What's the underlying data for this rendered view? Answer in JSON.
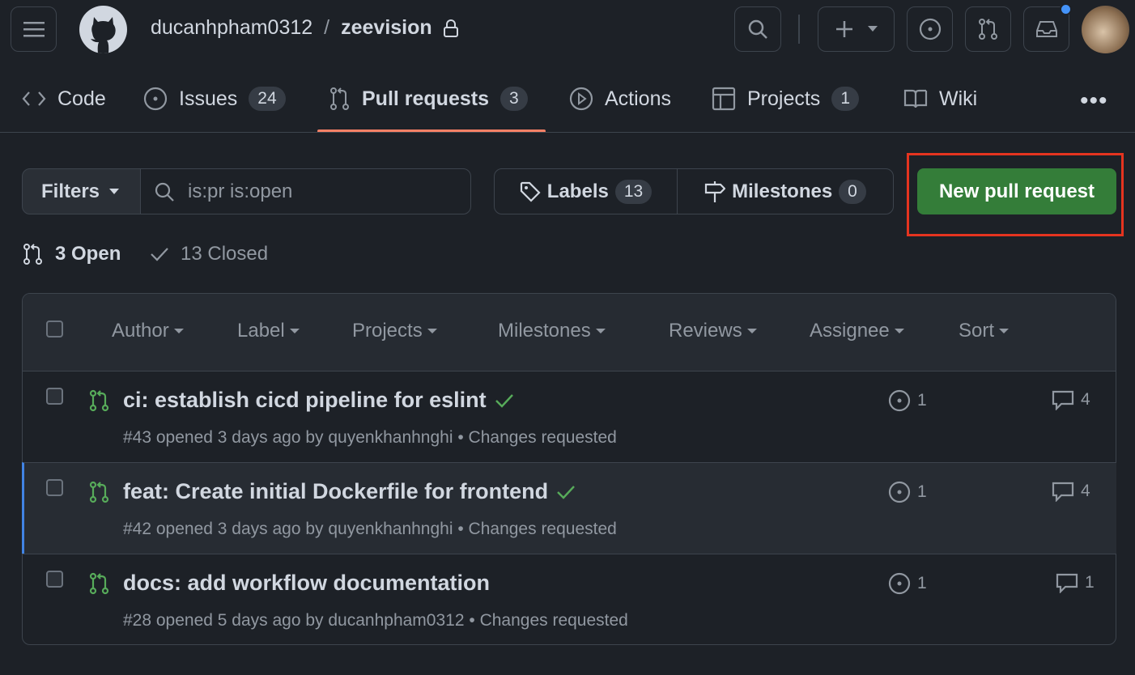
{
  "header": {
    "owner": "ducanhpham0312",
    "separator": "/",
    "repo": "zeevision"
  },
  "tabs": [
    {
      "label": "Code"
    },
    {
      "label": "Issues",
      "count": "24"
    },
    {
      "label": "Pull requests",
      "count": "3"
    },
    {
      "label": "Actions"
    },
    {
      "label": "Projects",
      "count": "1"
    },
    {
      "label": "Wiki"
    }
  ],
  "toolbar": {
    "filters_label": "Filters",
    "search_value": "is:pr is:open",
    "labels_label": "Labels",
    "labels_count": "13",
    "milestones_label": "Milestones",
    "milestones_count": "0",
    "new_pr_label": "New pull request"
  },
  "states": {
    "open": "3 Open",
    "closed": "13 Closed"
  },
  "filters": [
    "Author",
    "Label",
    "Projects",
    "Milestones",
    "Reviews",
    "Assignee",
    "Sort"
  ],
  "pulls": [
    {
      "title": "ci: establish cicd pipeline for eslint",
      "checks": "passed",
      "meta": "#43 opened 3 days ago by quyenkhanhnghi",
      "status": "Changes requested",
      "issues": "1",
      "comments": "4"
    },
    {
      "title": "feat: Create initial Dockerfile for frontend",
      "checks": "passed",
      "meta": "#42 opened 3 days ago by quyenkhanhnghi",
      "status": "Changes requested",
      "issues": "1",
      "comments": "4"
    },
    {
      "title": "docs: add workflow documentation",
      "meta": "#28 opened 5 days ago by ducanhpham0312",
      "status": "Changes requested",
      "issues": "1",
      "comments": "1"
    }
  ],
  "colors": {
    "accent_tab": "#f78166",
    "primary_button": "#347d39",
    "open_icon": "#57ab5a",
    "highlight": "#e5341f"
  }
}
